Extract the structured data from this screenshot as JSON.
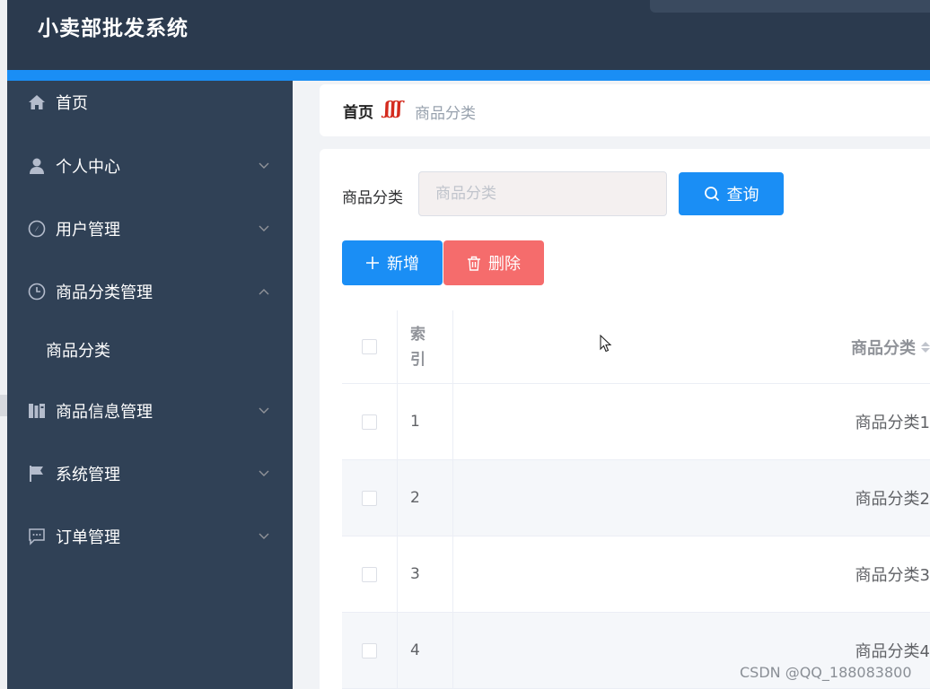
{
  "app": {
    "title": "小卖部批发系统"
  },
  "colors": {
    "primary": "#1a8ef5",
    "danger": "#f56c6c",
    "sidebar": "#304156",
    "header": "#2b3a4e"
  },
  "sidebar": {
    "items": [
      {
        "label": "首页",
        "icon": "home-icon"
      },
      {
        "label": "个人中心",
        "icon": "user-icon",
        "expandable": true
      },
      {
        "label": "用户管理",
        "icon": "compass-icon",
        "expandable": true
      },
      {
        "label": "商品分类管理",
        "icon": "clock-icon",
        "expandable": true,
        "expanded": true,
        "children": [
          {
            "label": "商品分类"
          }
        ]
      },
      {
        "label": "商品信息管理",
        "icon": "books-icon",
        "expandable": true
      },
      {
        "label": "系统管理",
        "icon": "flag-icon",
        "expandable": true
      },
      {
        "label": "订单管理",
        "icon": "chat-icon",
        "expandable": true
      }
    ]
  },
  "breadcrumb": {
    "home": "首页",
    "separator": "ʃʃʃ",
    "current": "商品分类"
  },
  "filter": {
    "label": "商品分类",
    "placeholder": "商品分类",
    "value": ""
  },
  "buttons": {
    "search": "查询",
    "add": "新增",
    "delete": "删除"
  },
  "table": {
    "headers": {
      "index": "索\n引",
      "name": "商品分类"
    },
    "rows": [
      {
        "index": "1",
        "name": "商品分类1"
      },
      {
        "index": "2",
        "name": "商品分类2"
      },
      {
        "index": "3",
        "name": "商品分类3"
      },
      {
        "index": "4",
        "name": "商品分类4"
      }
    ]
  },
  "watermark": "CSDN @QQ_188083800"
}
